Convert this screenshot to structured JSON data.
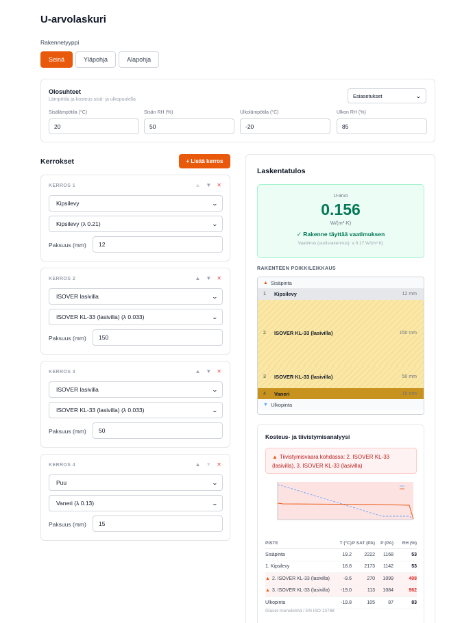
{
  "app": {
    "title": "U-arvolaskuri"
  },
  "structure_type": {
    "label": "Rakennetyyppi",
    "options": [
      "Seinä",
      "Yläpohja",
      "Alapohja"
    ],
    "selected": "Seinä"
  },
  "conditions": {
    "title": "Olosuhteet",
    "subtitle": "Lämpötila ja kosteus sisä- ja ulkopuolella",
    "preset_label": "Esiasetukset",
    "fields": [
      {
        "label": "Sisälämpötila (°C)",
        "value": "20"
      },
      {
        "label": "Sisän RH (%)",
        "value": "50"
      },
      {
        "label": "Ulkolämpötila (°C)",
        "value": "-20"
      },
      {
        "label": "Ulkon RH (%)",
        "value": "85"
      }
    ]
  },
  "layers_section": {
    "title": "Kerrokset",
    "add_button": "+ Lisää kerros",
    "thickness_label": "Paksuus (mm)",
    "layers": [
      {
        "heading": "KERROS 1",
        "category": "Kipsilevy",
        "material": "Kipsilevy (λ 0.21)",
        "thickness": "12"
      },
      {
        "heading": "KERROS 2",
        "category": "ISOVER lasivilla",
        "material": "ISOVER KL-33 (lasivilla) (λ 0.033)",
        "thickness": "150"
      },
      {
        "heading": "KERROS 3",
        "category": "ISOVER lasivilla",
        "material": "ISOVER KL-33 (lasivilla) (λ 0.033)",
        "thickness": "50"
      },
      {
        "heading": "KERROS 4",
        "category": "Puu",
        "material": "Vaneri (λ 0.13)",
        "thickness": "15"
      }
    ]
  },
  "result": {
    "title": "Laskentatulos",
    "u_label": "U-arvo",
    "u_value": "0.156",
    "u_unit": "W/(m²·K)",
    "status": "✓ Rakenne täyttää vaatimuksen",
    "requirement": "Vaatimus (uudisrakennus): ≤ 0.17 W/(m²·K)",
    "status_color": "#047857"
  },
  "cross_section": {
    "title": "RAKENTEEN POIKKILEIKKAUS",
    "inside_label": "Sisäpinta",
    "outside_label": "Ulkopinta",
    "layers": [
      {
        "num": "1",
        "name": "Kipsilevy",
        "thickness": "12 mm"
      },
      {
        "num": "2",
        "name": "ISOVER KL-33 (lasivilla)",
        "thickness": "150 mm"
      },
      {
        "num": "3",
        "name": "ISOVER KL-33 (lasivilla)",
        "thickness": "50 mm"
      },
      {
        "num": "4",
        "name": "Vaneri",
        "thickness": "15 mm"
      }
    ]
  },
  "moisture": {
    "title": "Kosteus- ja tiivistymisanalyysi",
    "warning": "Tiivistymisvaara kohdassa: 2. ISOVER KL-33 (lasivilla), 3. ISOVER KL-33 (lasivilla)",
    "table_headers": [
      "PISTE",
      "T (°C)",
      "P SAT (PA)",
      "P (PA)",
      "RH (%)"
    ],
    "rows": [
      {
        "name": "Sisäpinta",
        "t": "19.2",
        "psat": "2222",
        "p": "1168",
        "rh": "53",
        "warn": false
      },
      {
        "name": "1. Kipsilevy",
        "t": "18.8",
        "psat": "2173",
        "p": "1142",
        "rh": "53",
        "warn": false
      },
      {
        "name": "2. ISOVER KL-33 (lasivilla)",
        "t": "-9.6",
        "psat": "270",
        "p": "1099",
        "rh": "408",
        "warn": true
      },
      {
        "name": "3. ISOVER KL-33 (lasivilla)",
        "t": "-19.0",
        "psat": "113",
        "p": "1084",
        "rh": "962",
        "warn": true
      },
      {
        "name": "Ulkopinta",
        "t": "-19.8",
        "psat": "105",
        "p": "87",
        "rh": "83",
        "warn": false
      }
    ],
    "method": "Glaser-menetelmä / EN ISO 13788",
    "colors": {
      "psat_line": "#60a5fa",
      "p_line": "#e8590c",
      "risk_fill": "#fde2e2"
    }
  }
}
